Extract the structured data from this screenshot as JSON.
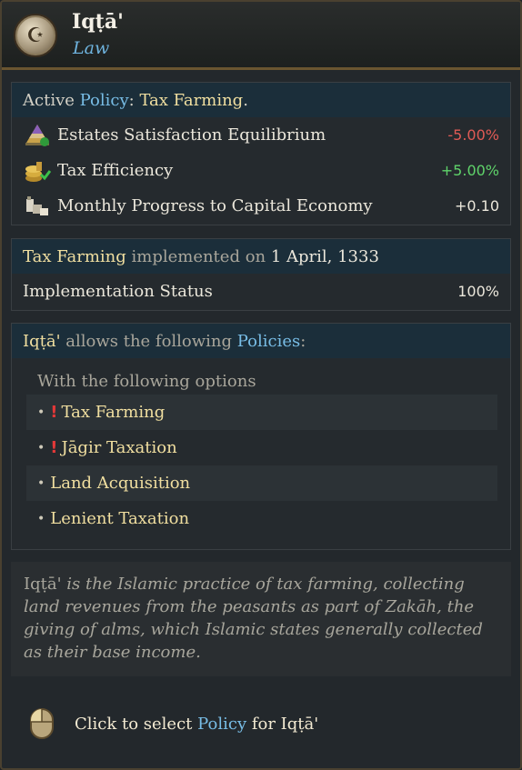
{
  "header": {
    "title": "Iqṭā'",
    "subtitle": "Law",
    "emblem_icon": "crescent-star-icon"
  },
  "policy": {
    "prefix": "Active",
    "policy_word": "Policy",
    "colon": ":",
    "name": "Tax Farming",
    "period": ".",
    "modifiers": [
      {
        "icon": "estates-pyramid-icon",
        "label": "Estates Satisfaction Equilibrium",
        "value": "-5.00%"
      },
      {
        "icon": "tax-coins-icon",
        "label": "Tax Efficiency",
        "value": "+5.00%"
      },
      {
        "icon": "capital-economy-icon",
        "label": "Monthly Progress to Capital Economy",
        "value": "+0.10"
      }
    ]
  },
  "implementation": {
    "name": "Tax Farming",
    "middle": " implemented on ",
    "date": "1 April, 1333",
    "status_label": "Implementation Status",
    "status_value": "100%"
  },
  "allows": {
    "law_name": "Iqṭā'",
    "middle": " allows the following ",
    "policies_word": "Policies",
    "colon": ":",
    "subheading": "With the following options",
    "options": [
      {
        "label": "Tax Farming",
        "warning": "!"
      },
      {
        "label": "Jāgir Taxation",
        "warning": "!"
      },
      {
        "label": "Land Acquisition",
        "warning": ""
      },
      {
        "label": "Lenient Taxation",
        "warning": ""
      }
    ]
  },
  "description": {
    "name": "Iqṭā'",
    "text": " is the Islamic practice of tax farming, collecting land revenues from the peasants as part of Zakāh, the giving of alms, which Islamic states generally collected as their base income."
  },
  "footer": {
    "prefix": "Click to select ",
    "policy_word": "Policy",
    "suffix": " for Iqṭā'",
    "icon": "mouse-icon"
  },
  "colors": {
    "gold": "#f1dfa0",
    "blue": "#78bde6",
    "negative": "#e05a55",
    "positive": "#5fd36a"
  }
}
